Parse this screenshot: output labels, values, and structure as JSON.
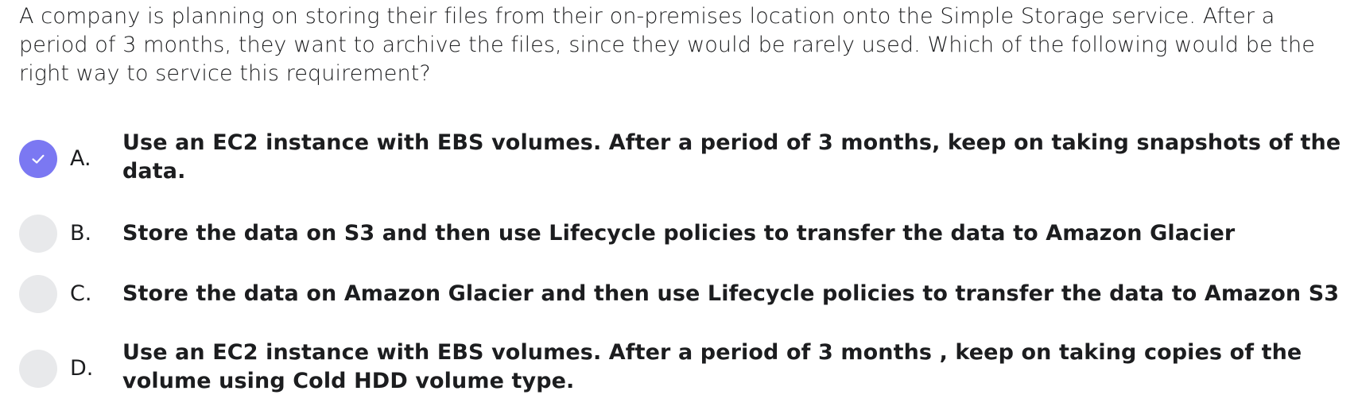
{
  "question": {
    "text": "A company is planning on storing their files from their on-premises location onto the Simple Storage service. After a period of 3 months, they want to archive the files, since they would be rarely used. Which of the following would be the right way to service this requirement?"
  },
  "options": [
    {
      "letter": "A.",
      "text": "Use an EC2 instance with EBS volumes. After a period of 3 months, keep on taking snapshots of the data.",
      "selected": true
    },
    {
      "letter": "B.",
      "text": "Store the data on S3 and then use Lifecycle policies to transfer the data to Amazon Glacier",
      "selected": false
    },
    {
      "letter": "C.",
      "text": "Store the data on Amazon Glacier and then use Lifecycle policies to transfer the data to Amazon S3",
      "selected": false
    },
    {
      "letter": "D.",
      "text": "Use an EC2 instance with EBS volumes. After a period of 3 months , keep on taking copies of the volume using Cold HDD volume type.",
      "selected": false
    }
  ],
  "colors": {
    "selected_radio": "#7b78f2",
    "unselected_radio": "#e8e9eb",
    "text": "#1c1d1f"
  },
  "icons": {
    "selected_mark": "checkmark-icon"
  }
}
